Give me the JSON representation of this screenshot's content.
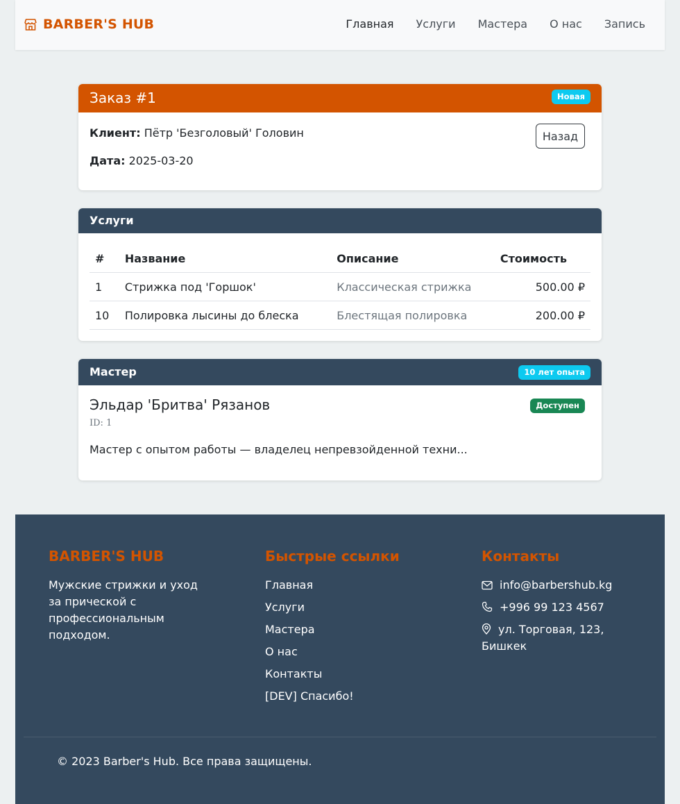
{
  "navbar": {
    "brand": "BARBER'S HUB",
    "links": [
      "Главная",
      "Услуги",
      "Мастера",
      "О нас",
      "Запись"
    ]
  },
  "order": {
    "title": "Заказ #1",
    "status": "Новая",
    "client_label": "Клиент:",
    "client": "Пётр 'Безголовый' Головин",
    "date_label": "Дата:",
    "date": "2025-03-20",
    "back_label": "Назад"
  },
  "services": {
    "title": "Услуги",
    "columns": [
      "#",
      "Название",
      "Описание",
      "Стоимость"
    ],
    "rows": [
      {
        "id": "1",
        "name": "Стрижка под 'Горшок'",
        "description": "Классическая стрижка",
        "price": "500.00 ₽"
      },
      {
        "id": "10",
        "name": "Полировка лысины до блеска",
        "description": "Блестящая полировка",
        "price": "200.00 ₽"
      }
    ]
  },
  "master": {
    "title": "Мастер",
    "experience": "10 лет опыта",
    "name": "Эльдар 'Бритва' Рязанов",
    "availability": "Доступен",
    "id": "ID: 1",
    "description": "Мастер с опытом работы — владелец непревзойденной техни..."
  },
  "footer": {
    "brand": "BARBER'S HUB",
    "tagline": "Мужские стрижки и уход за прической с профессиональным подходом.",
    "links_title": "Быстрые ссылки",
    "links": [
      "Главная",
      "Услуги",
      "Мастера",
      "О нас",
      "Контакты",
      "[DEV] Спасибо!"
    ],
    "contacts_title": "Контакты",
    "email": "info@barbershub.kg",
    "phone": "+996 99 123 4567",
    "address": "ул. Торговая, 123, Бишкек",
    "copyright": "© 2023 Barber's Hub. Все права защищены."
  },
  "colors": {
    "accent": "#d35400",
    "dark": "#34495e",
    "info": "#0dcaf0",
    "success": "#198754"
  }
}
